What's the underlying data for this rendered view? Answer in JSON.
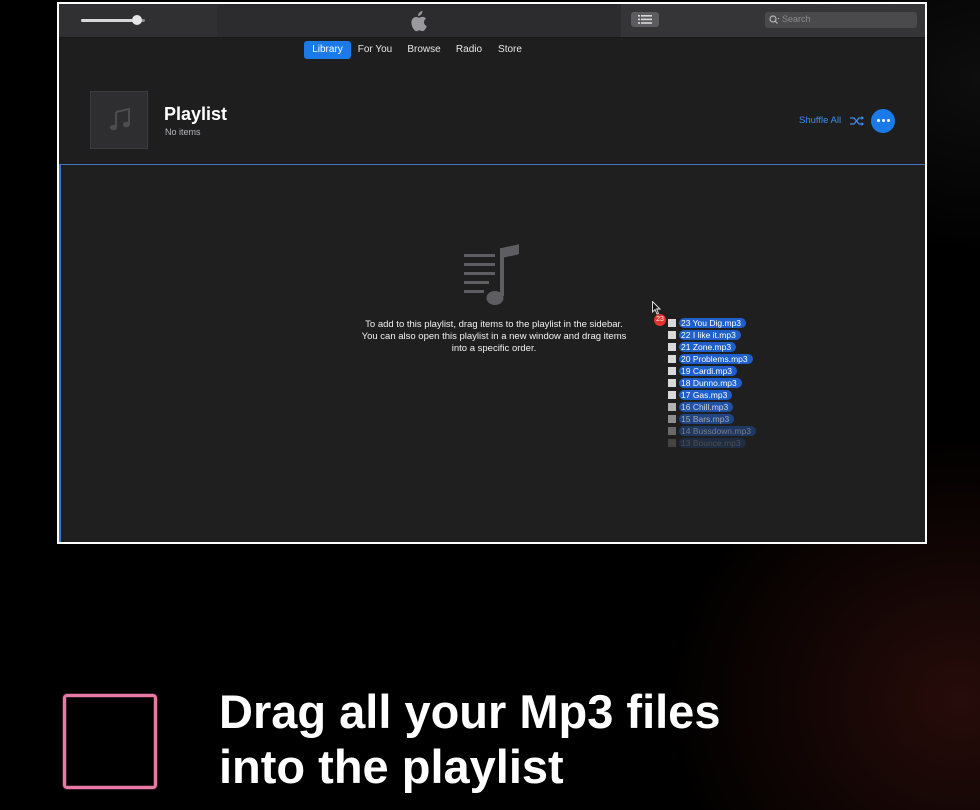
{
  "nav": {
    "tabs": [
      {
        "label": "Library",
        "active": true
      },
      {
        "label": "For You",
        "active": false
      },
      {
        "label": "Browse",
        "active": false
      },
      {
        "label": "Radio",
        "active": false
      },
      {
        "label": "Store",
        "active": false
      }
    ]
  },
  "search": {
    "placeholder": "Search"
  },
  "playlist": {
    "title": "Playlist",
    "subtitle": "No items",
    "shuffle_label": "Shuffle All"
  },
  "drop_area": {
    "instructions": "To add to this playlist, drag items to the playlist in the sidebar. You can also open this playlist in a new window and drag items into a specific order.",
    "drag_count": "23",
    "dragged_files": [
      "23 You Dig.mp3",
      "22 I like it.mp3",
      "21 Zone.mp3",
      "20 Problems.mp3",
      "19 Cardi.mp3",
      "18 Dunno.mp3",
      "17 Gas.mp3",
      "16 Chill.mp3",
      "15 Bars.mp3",
      "14 Bussdown.mp3",
      "13 Bounce.mp3"
    ]
  },
  "caption": {
    "line1": "Drag all your Mp3 files",
    "line2": "into the playlist"
  },
  "colors": {
    "accent": "#1a7be8",
    "caption_box": "#e87ba5",
    "badge": "#e0332c"
  },
  "volume_level": 0.88
}
